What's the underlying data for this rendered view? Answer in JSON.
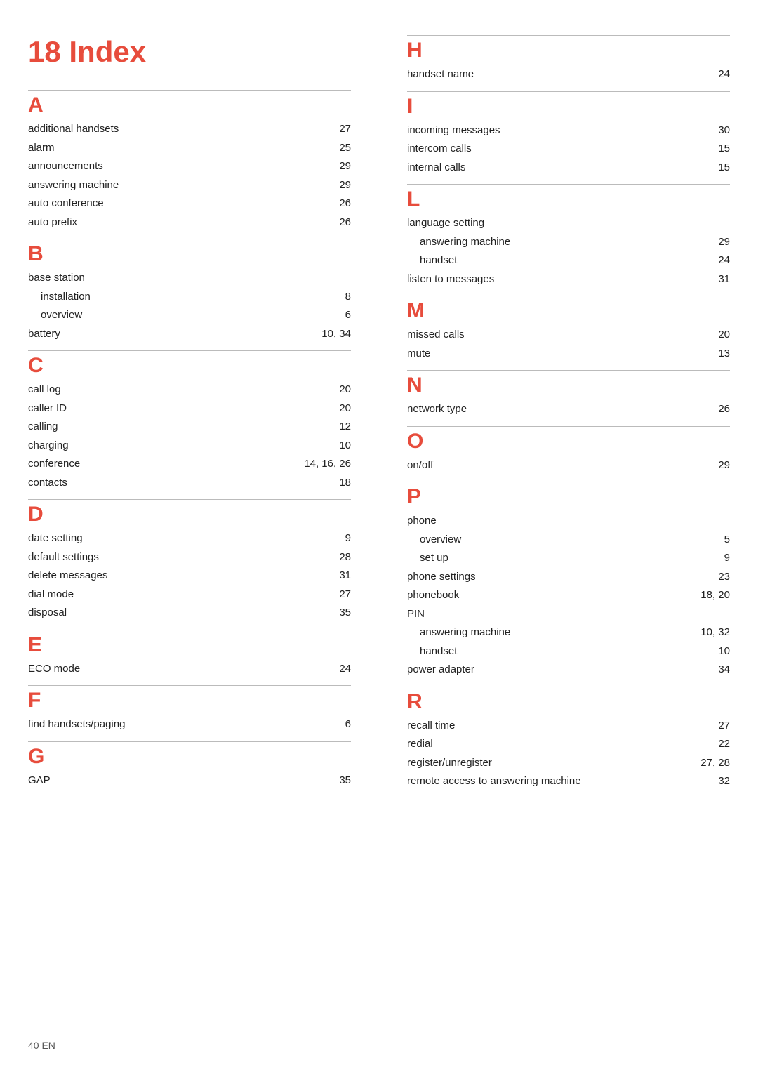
{
  "title": "18 Index",
  "footer": "40  EN",
  "left_sections": [
    {
      "letter": "A",
      "items": [
        {
          "label": "additional handsets",
          "page": "27",
          "indent": false
        },
        {
          "label": "alarm",
          "page": "25",
          "indent": false
        },
        {
          "label": "announcements",
          "page": "29",
          "indent": false
        },
        {
          "label": "answering machine",
          "page": "29",
          "indent": false
        },
        {
          "label": "auto conference",
          "page": "26",
          "indent": false
        },
        {
          "label": "auto prefix",
          "page": "26",
          "indent": false
        }
      ]
    },
    {
      "letter": "B",
      "items": [
        {
          "label": "base station",
          "page": "",
          "indent": false
        },
        {
          "label": "installation",
          "page": "8",
          "indent": true
        },
        {
          "label": "overview",
          "page": "6",
          "indent": true
        },
        {
          "label": "battery",
          "page": "10, 34",
          "indent": false
        }
      ]
    },
    {
      "letter": "C",
      "items": [
        {
          "label": "call log",
          "page": "20",
          "indent": false
        },
        {
          "label": "caller ID",
          "page": "20",
          "indent": false
        },
        {
          "label": "calling",
          "page": "12",
          "indent": false
        },
        {
          "label": "charging",
          "page": "10",
          "indent": false
        },
        {
          "label": "conference",
          "page": "14, 16, 26",
          "indent": false
        },
        {
          "label": "contacts",
          "page": "18",
          "indent": false
        }
      ]
    },
    {
      "letter": "D",
      "items": [
        {
          "label": "date setting",
          "page": "9",
          "indent": false
        },
        {
          "label": "default settings",
          "page": "28",
          "indent": false
        },
        {
          "label": "delete messages",
          "page": "31",
          "indent": false
        },
        {
          "label": "dial mode",
          "page": "27",
          "indent": false
        },
        {
          "label": "disposal",
          "page": "35",
          "indent": false
        }
      ]
    },
    {
      "letter": "E",
      "items": [
        {
          "label": "ECO mode",
          "page": "24",
          "indent": false
        }
      ]
    },
    {
      "letter": "F",
      "items": [
        {
          "label": "find handsets/paging",
          "page": "6",
          "indent": false
        }
      ]
    },
    {
      "letter": "G",
      "items": [
        {
          "label": "GAP",
          "page": "35",
          "indent": false
        }
      ]
    }
  ],
  "right_sections": [
    {
      "letter": "H",
      "items": [
        {
          "label": "handset name",
          "page": "24",
          "indent": false
        }
      ]
    },
    {
      "letter": "I",
      "items": [
        {
          "label": "incoming messages",
          "page": "30",
          "indent": false
        },
        {
          "label": "intercom calls",
          "page": "15",
          "indent": false
        },
        {
          "label": "internal calls",
          "page": "15",
          "indent": false
        }
      ]
    },
    {
      "letter": "L",
      "items": [
        {
          "label": "language setting",
          "page": "",
          "indent": false
        },
        {
          "label": "answering machine",
          "page": "29",
          "indent": true
        },
        {
          "label": "handset",
          "page": "24",
          "indent": true
        },
        {
          "label": "listen to messages",
          "page": "31",
          "indent": false
        }
      ]
    },
    {
      "letter": "M",
      "items": [
        {
          "label": "missed calls",
          "page": "20",
          "indent": false
        },
        {
          "label": "mute",
          "page": "13",
          "indent": false
        }
      ]
    },
    {
      "letter": "N",
      "items": [
        {
          "label": "network type",
          "page": "26",
          "indent": false
        }
      ]
    },
    {
      "letter": "O",
      "items": [
        {
          "label": "on/off",
          "page": "29",
          "indent": false
        }
      ]
    },
    {
      "letter": "P",
      "items": [
        {
          "label": "phone",
          "page": "",
          "indent": false
        },
        {
          "label": "overview",
          "page": "5",
          "indent": true
        },
        {
          "label": "set up",
          "page": "9",
          "indent": true
        },
        {
          "label": "phone settings",
          "page": "23",
          "indent": false
        },
        {
          "label": "phonebook",
          "page": "18, 20",
          "indent": false
        },
        {
          "label": "PIN",
          "page": "",
          "indent": false
        },
        {
          "label": "answering machine",
          "page": "10, 32",
          "indent": true
        },
        {
          "label": "handset",
          "page": "10",
          "indent": true
        },
        {
          "label": "power adapter",
          "page": "34",
          "indent": false
        }
      ]
    },
    {
      "letter": "R",
      "items": [
        {
          "label": "recall time",
          "page": "27",
          "indent": false
        },
        {
          "label": "redial",
          "page": "22",
          "indent": false
        },
        {
          "label": "register/unregister",
          "page": "27, 28",
          "indent": false
        },
        {
          "label": "remote access to answering machine",
          "page": "32",
          "indent": false
        }
      ]
    }
  ]
}
